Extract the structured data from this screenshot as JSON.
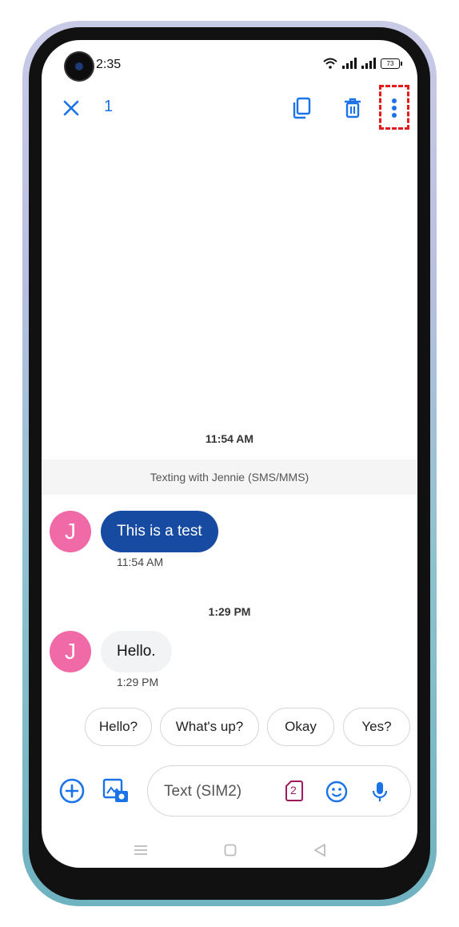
{
  "status_bar": {
    "time": "2:35",
    "battery": "73"
  },
  "action_bar": {
    "selected_count": "1",
    "icons": [
      "close-icon",
      "copy-icon",
      "delete-icon",
      "more-options-icon"
    ]
  },
  "conversation": {
    "first_timestamp": "11:54 AM",
    "banner": "Texting with Jennie (SMS/MMS)",
    "messages": [
      {
        "avatar": "J",
        "text": "This is a test",
        "time": "11:54 AM",
        "selected": true
      },
      {
        "avatar": "J",
        "text": "Hello.",
        "time": "1:29 PM",
        "selected": false
      }
    ],
    "second_timestamp": "1:29 PM"
  },
  "smart_replies": [
    "Hello?",
    "What's up?",
    "Okay",
    "Yes?"
  ],
  "composer": {
    "placeholder": "Text (SIM2)",
    "sim_badge": "2"
  },
  "colors": {
    "accent": "#1a73e8",
    "selected_bubble": "#164ba1",
    "avatar": "#f06aa8",
    "highlight": "#e21b1b"
  }
}
